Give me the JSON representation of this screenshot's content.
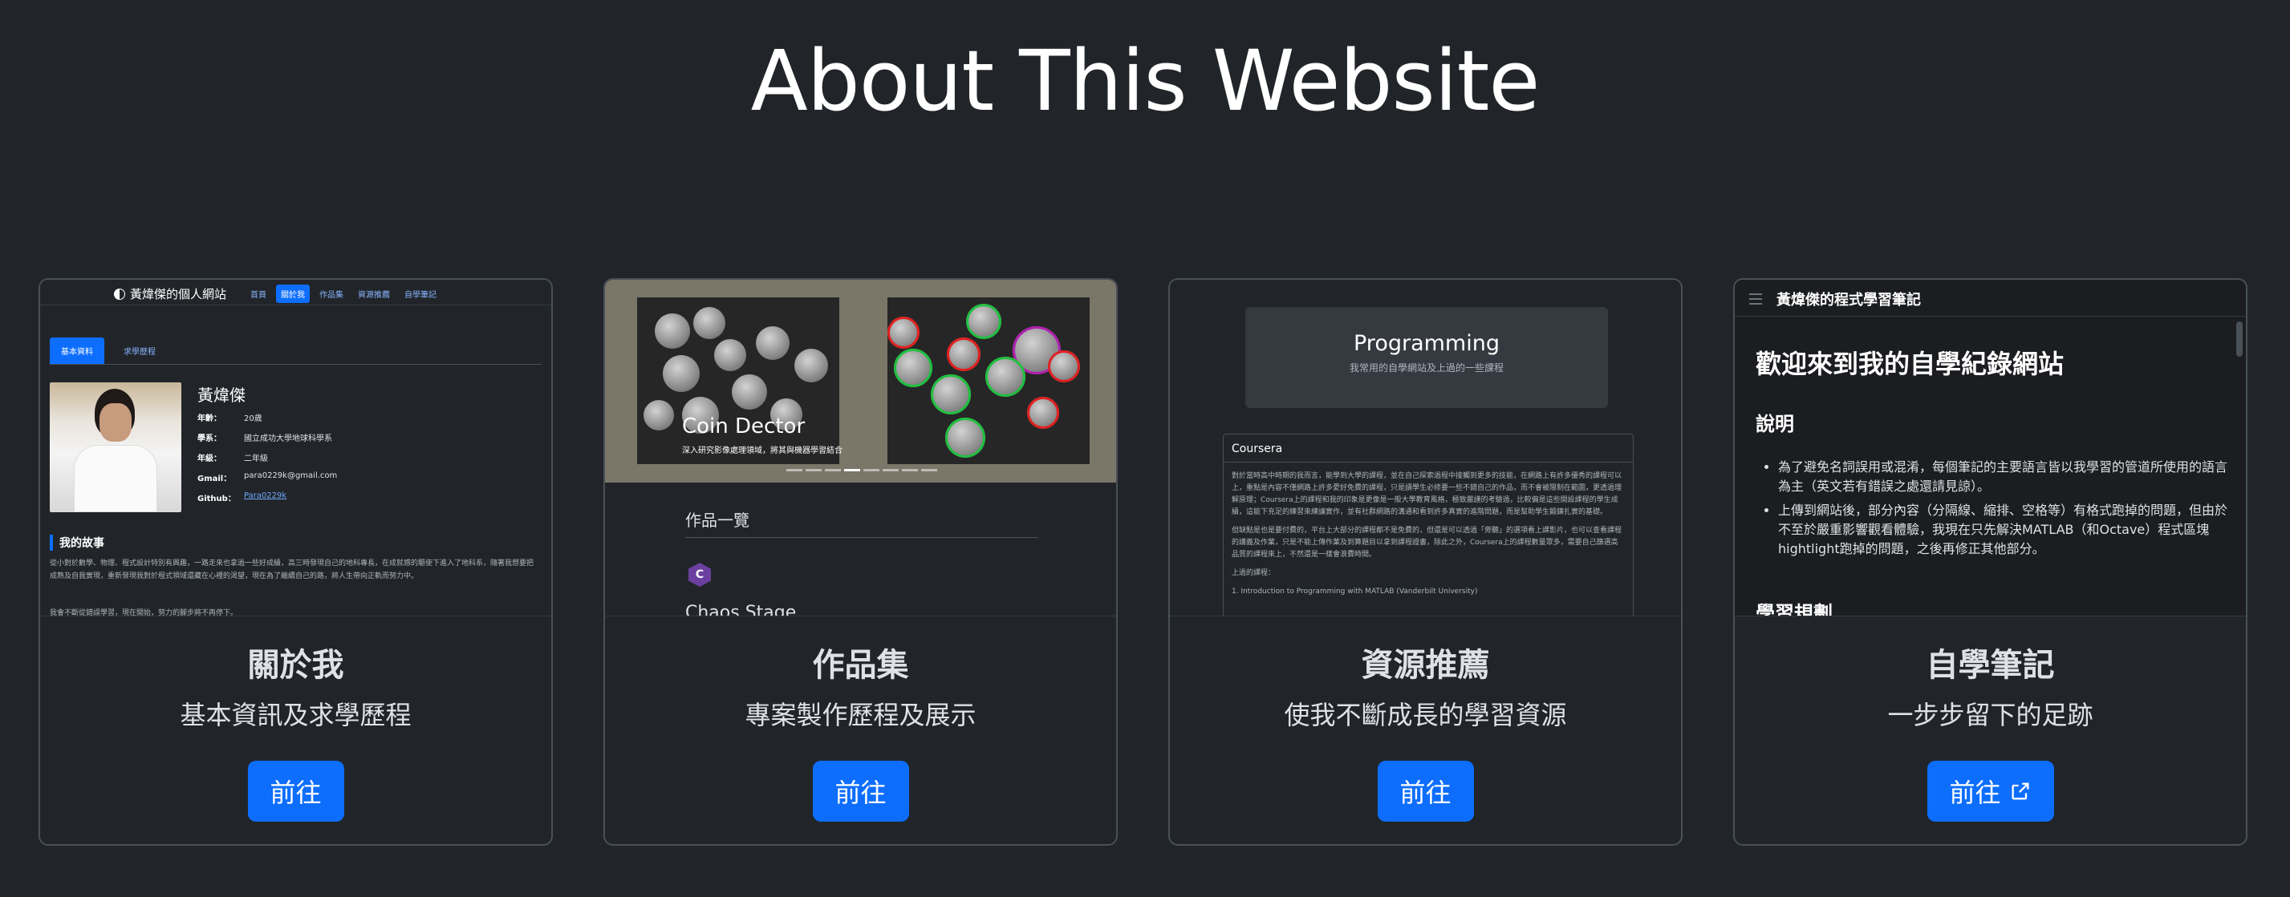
{
  "page": {
    "title": "About This Website"
  },
  "colors": {
    "background": "#212529",
    "primary_button": "#0d6efd",
    "card_border": "#495057"
  },
  "cards": [
    {
      "title": "關於我",
      "text": "基本資訊及求學歷程",
      "button": "前往",
      "preview": {
        "brand": "黃煒傑的個人網站",
        "nav": [
          "首頁",
          "關於我",
          "作品集",
          "資源推薦",
          "自學筆記"
        ],
        "tabs": [
          "基本資料",
          "求學歷程"
        ],
        "name": "黃煒傑",
        "info": [
          {
            "k": "年齡：",
            "v": "20歲"
          },
          {
            "k": "學系：",
            "v": "國立成功大學地球科學系"
          },
          {
            "k": "年級：",
            "v": "二年級"
          },
          {
            "k": "Gmail：",
            "v": "para0229k@gmail.com"
          },
          {
            "k": "Github：",
            "v": "Para0229k"
          }
        ],
        "story_heading": "我的故事",
        "story": "從小對於數學、物理、程式設計特別有興趣，一路走來也拿過一些好成績，高三時發現自己的地科專長，在成就感的驅使下進入了地科系，隨著我想要把成熟及自我實現，重新發現我對於程式領域還藏在心裡的渴望，現在為了繼續自己的路，將人生帶向正軌而努力中。",
        "story2": "我會不斷從錯誤學習，現在開始，努力的腳步將不再停下。"
      }
    },
    {
      "title": "作品集",
      "text": "專案製作歷程及展示",
      "button": "前往",
      "preview": {
        "caption": "Coin Dector",
        "caption_sub": "深入研究影像處理領域，將其與機器學習結合",
        "list_heading": "作品一覽",
        "item": "Chaos Stage"
      }
    },
    {
      "title": "資源推薦",
      "text": "使我不斷成長的學習資源",
      "button": "前往",
      "preview": {
        "heading": "Programming",
        "sub": "我常用的自學網站及上過的一些課程",
        "panel_title": "Coursera",
        "p1": "對於當時高中時期的我而言，能學到大學的課程，並在自己探索過程中接觸到更多的技能，在網路上有許多優秀的課程可以上，重點是內容不僅網路上許多愛好免費的課程，只是讀學生必修要一些不錯自己的作品，而不會被限制在範圍，更透過理解原理；Coursera上的課程和我的印象是更像是一般大學教育風格，極致嚴謹的考驗過，比較偏是這些開設課程的學生成績，這能下充足的練習來練讓實作，並有社群網路的溝通和看到許多真實的進階問題，而是幫助學生鍛鍊扎實的基礎。",
        "p2": "但缺點是也是要付費的，平台上大部分的課程都不是免費的，但還是可以透過「旁聽」的選項看上課影片，也可以查看課程的講義及作業，只是不能上傳作業及到算題目以拿到課程證書，除此之外，Coursera上的課程數量眾多，需要自己篩選高品質的課程來上，不然還是一樣會浪費時間。",
        "p3": "上過的課程：",
        "li1": "1. Introduction to Programming with MATLAB (Vanderbilt University)"
      }
    },
    {
      "title": "自學筆記",
      "text": "一步步留下的足跡",
      "button": "前往",
      "button_icon": "external-link-icon",
      "preview": {
        "bar_title": "黃煒傑的程式學習筆記",
        "h1": "歡迎來到我的自學紀錄網站",
        "h2": "說明",
        "bullets": [
          "為了避免名詞誤用或混淆，每個筆記的主要語言皆以我學習的管道所使用的語言為主（英文若有錯誤之處還請見諒）。",
          "上傳到網站後，部分內容（分隔線、縮排、空格等）有格式跑掉的問題，但由於不至於嚴重影響觀看體驗，我現在只先解決MATLAB（和Octave）程式區塊hightlight跑掉的問題，之後再修正其他部分。"
        ],
        "h3": "學習規劃"
      }
    }
  ]
}
